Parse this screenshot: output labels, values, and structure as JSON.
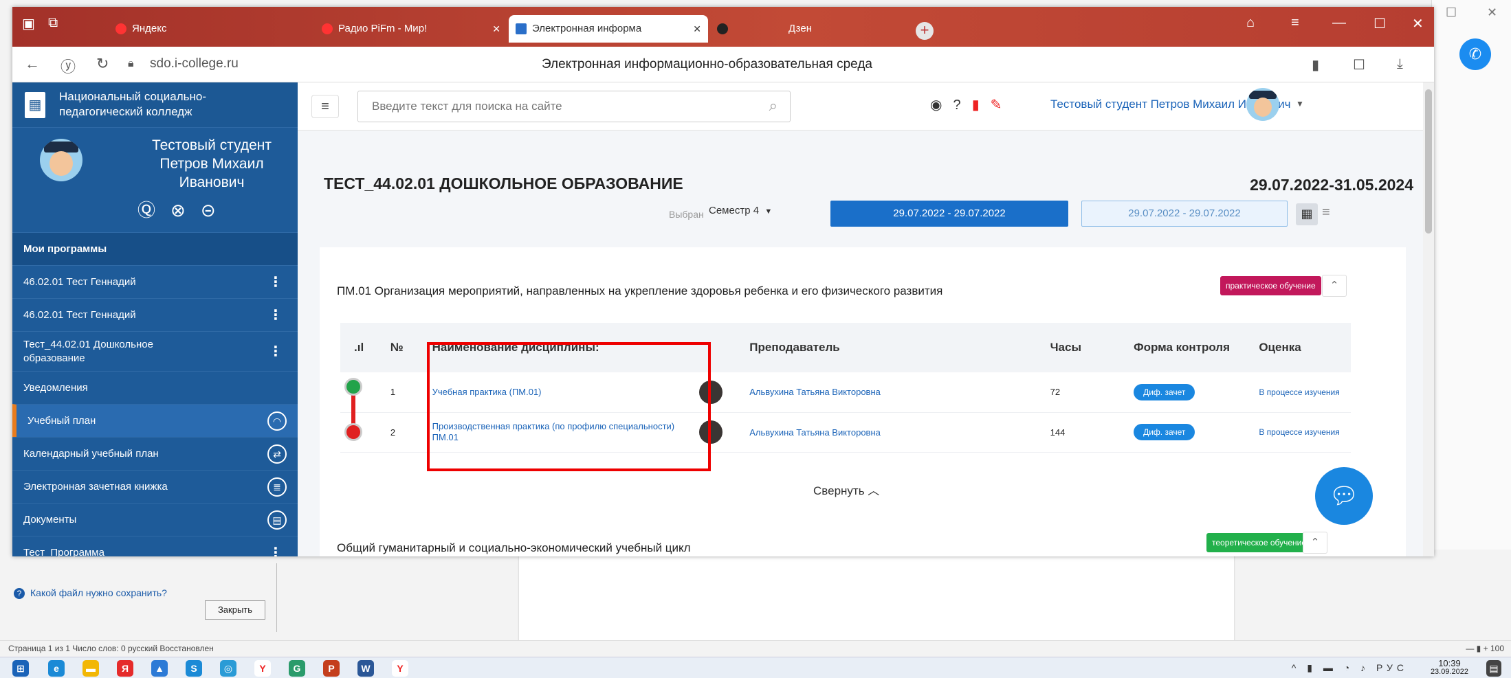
{
  "browser": {
    "tabs": [
      {
        "label": "Яндекс",
        "color": "#ff3333"
      },
      {
        "label": "Радио PiFm - Мир!",
        "color": "#ff3333"
      },
      {
        "label": "Электронная информа",
        "color": "#2a6fc9"
      },
      {
        "label": "Дзен",
        "color": "#222222"
      }
    ],
    "url": "sdo.i-college.ru",
    "page_title": "Электронная информационно-образовательная среда"
  },
  "sidebar": {
    "brand": "Национальный социально-\nпедагогический колледж",
    "user_name": "Тестовый студент Петров Михаил Иванович",
    "section_header": "Мои программы",
    "programs": [
      {
        "label": "46.02.01 Тест Геннадий"
      },
      {
        "label": "46.02.01 Тест Геннадий"
      },
      {
        "label": "Тест_44.02.01 Дошкольное образование"
      }
    ],
    "nav": [
      {
        "label": "Уведомления"
      },
      {
        "label": "Учебный план"
      },
      {
        "label": "Календарный учебный план"
      },
      {
        "label": "Электронная зачетная книжка"
      },
      {
        "label": "Документы"
      },
      {
        "label": "Тест_Программа"
      }
    ]
  },
  "topbar": {
    "search_placeholder": "Введите текст для поиска на сайте",
    "user_link": "Тестовый студент Петров Михаил Иванович"
  },
  "main": {
    "title": "ТЕСТ_44.02.01 ДОШКОЛЬНОЕ ОБРАЗОВАНИЕ",
    "period": "29.07.2022-31.05.2024",
    "semester_label": "Выбран",
    "semester_value": "Семестр 4",
    "date_range_1": "29.07.2022 - 29.07.2022",
    "date_range_2": "29.07.2022 - 29.07.2022",
    "module1": {
      "title": "ПМ.01 Организация мероприятий, направленных на укрепление здоровья ребенка и его физического развития",
      "badge": "практическое обучение"
    },
    "table": {
      "headers": [
        "№",
        "Наименование дисциплины:",
        "Преподаватель",
        "Часы",
        "Форма контроля",
        "Оценка"
      ],
      "rows": [
        {
          "num": "1",
          "discipline": "Учебная практика (ПМ.01)",
          "teacher": "Альвухина Татьяна Викторовна",
          "hours": "72",
          "form": "Диф. зачет",
          "grade": "В процессе изучения"
        },
        {
          "num": "2",
          "discipline": "Производственная практика (по профилю специальности) ПМ.01",
          "teacher": "Альвухина Татьяна Викторовна",
          "hours": "144",
          "form": "Диф. зачет",
          "grade": "В процессе изучения"
        }
      ]
    },
    "collapse_label": "Свернуть",
    "module2": {
      "title": "Общий гуманитарный и социально-экономический учебный цикл",
      "badge": "теоретическое обучение"
    }
  },
  "word": {
    "help_link": "Какой файл нужно сохранить?",
    "close_button": "Закрыть",
    "status_text": "Страница 1 из 1   Число слов: 0   русский   Восстановлен",
    "zoom": "100"
  },
  "taskbar": {
    "time": "10:39",
    "date": "23.09.2022",
    "lang": "РУС"
  },
  "colors": {
    "sidebar": "#1e5b99",
    "accent": "#1a6fc9",
    "badge_practical": "#c2185b",
    "badge_theory": "#22b04b",
    "highlight_box": "#ee0000"
  }
}
